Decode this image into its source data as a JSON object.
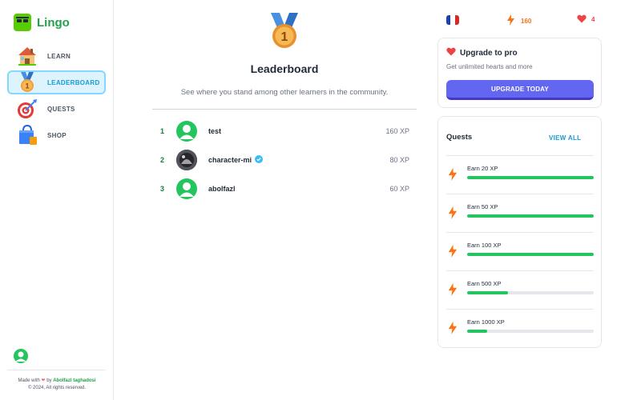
{
  "app": {
    "name": "Lingo"
  },
  "sidebar": {
    "items": [
      {
        "label": "LEARN",
        "icon": "house-icon",
        "active": false
      },
      {
        "label": "LEADERBOARD",
        "icon": "medal-icon",
        "active": true
      },
      {
        "label": "QUESTS",
        "icon": "target-icon",
        "active": false
      },
      {
        "label": "SHOP",
        "icon": "shopping-bag-icon",
        "active": false
      }
    ],
    "footer": {
      "made_with": "Made with",
      "by": "by",
      "author": "Abolfazl taghadosi",
      "copyright": "© 2024, All rights reserved."
    }
  },
  "main": {
    "medal_number": "1",
    "title": "Leaderboard",
    "subtitle": "See where you stand among other learners in the community.",
    "leaderboard": [
      {
        "rank": "1",
        "name": "test",
        "xp": "160 XP",
        "verified": false
      },
      {
        "rank": "2",
        "name": "character-mi",
        "xp": "80 XP",
        "verified": true
      },
      {
        "rank": "3",
        "name": "abolfazl",
        "xp": "60 XP",
        "verified": false
      }
    ]
  },
  "topbar": {
    "language_flag": "france-flag-icon",
    "xp": "160",
    "hearts": "4"
  },
  "promo": {
    "title": "Upgrade to pro",
    "subtitle": "Get unlimited hearts and more",
    "button": "UPGRADE TODAY"
  },
  "quests": {
    "title": "Quests",
    "view_all": "VIEW ALL",
    "items": [
      {
        "label": "Earn 20 XP",
        "progress": 1.0
      },
      {
        "label": "Earn 50 XP",
        "progress": 1.0
      },
      {
        "label": "Earn 100 XP",
        "progress": 1.0
      },
      {
        "label": "Earn 500 XP",
        "progress": 0.32
      },
      {
        "label": "Earn 1000 XP",
        "progress": 0.16
      }
    ]
  },
  "colors": {
    "brand_green": "#22a04b",
    "active_blue": "#1899d6",
    "button_indigo": "#6366f1",
    "progress_green": "#22c55e",
    "xp_orange": "#f97316",
    "heart_red": "#ef4444"
  }
}
